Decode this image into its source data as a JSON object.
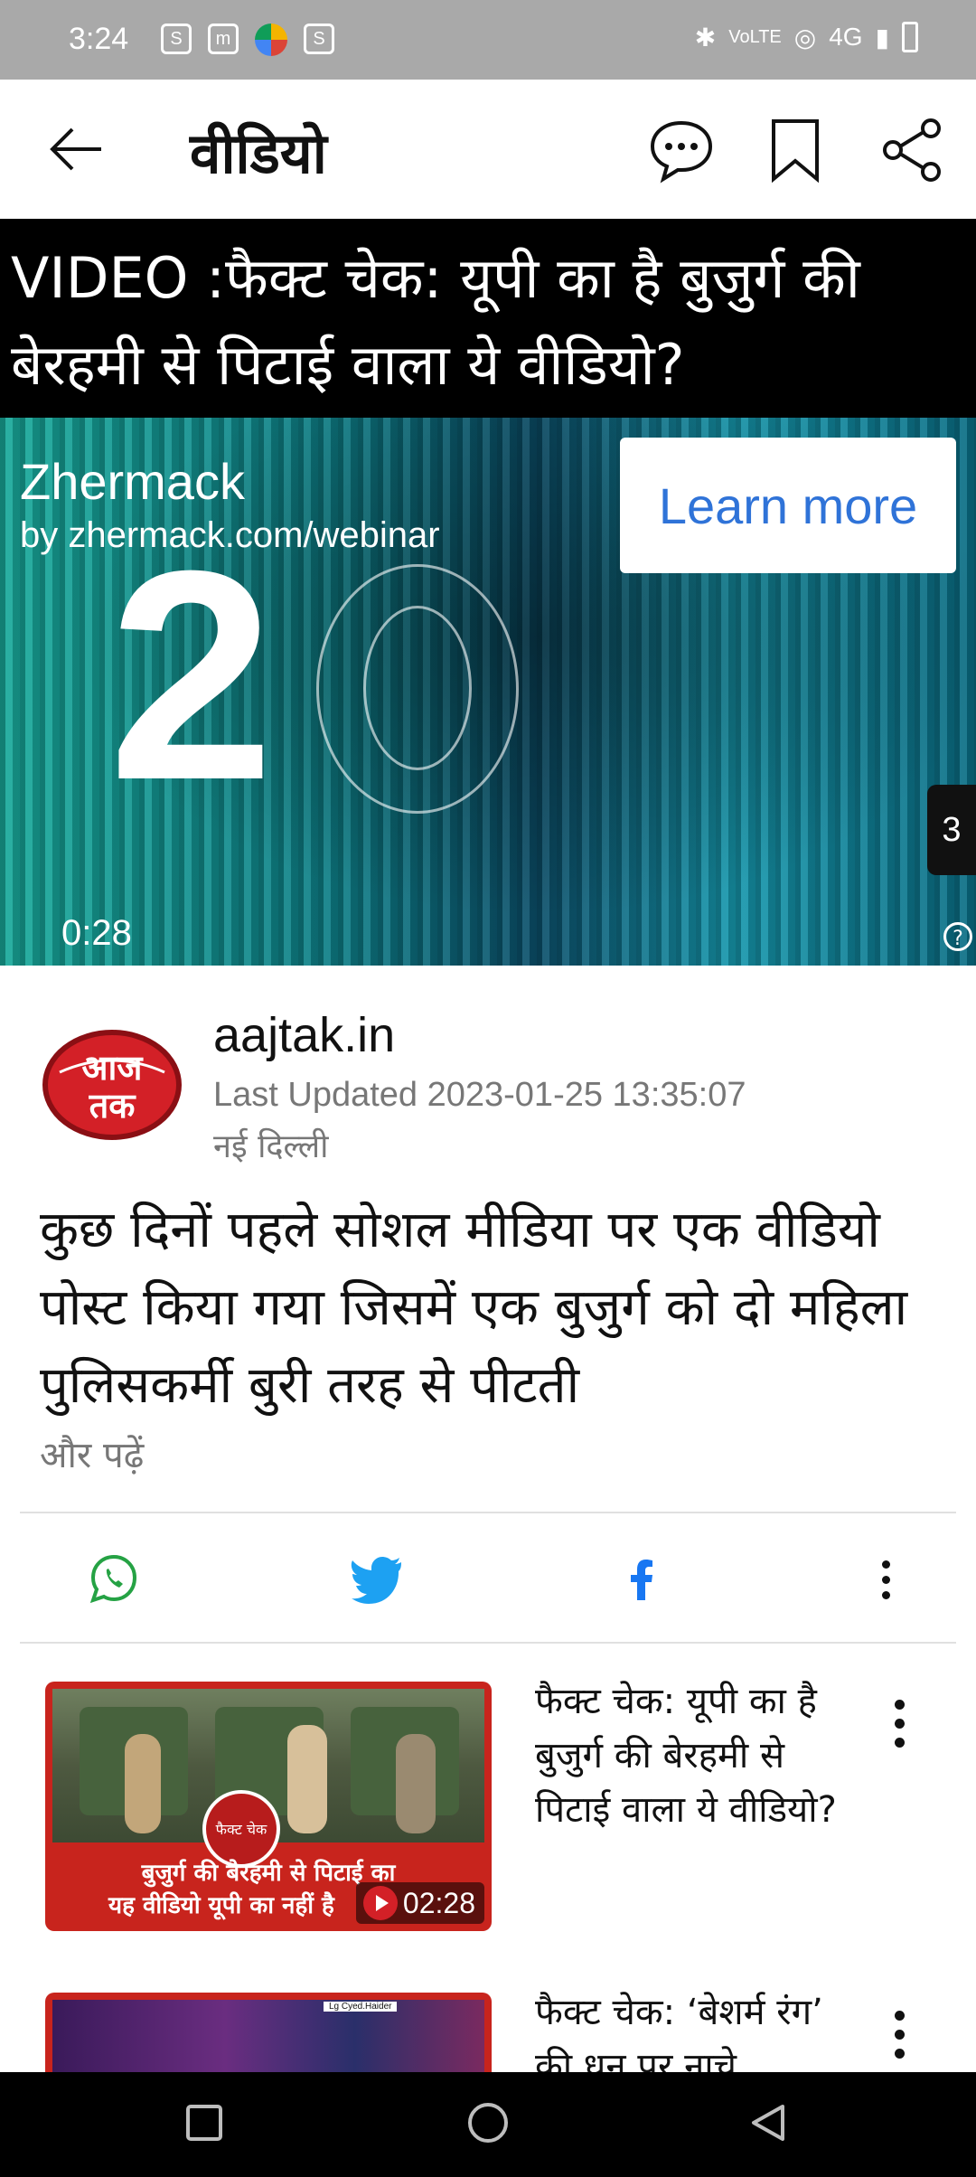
{
  "status_bar": {
    "time": "3:24",
    "network": "4G",
    "icons": [
      "sim-icon",
      "app-icon",
      "chrome-icon",
      "sim-icon",
      "bluetooth-icon",
      "volte-icon",
      "hotspot-icon",
      "signal-icon",
      "battery-icon"
    ]
  },
  "app_bar": {
    "title": "वीडियो",
    "icons": [
      "back-arrow-icon",
      "comment-icon",
      "bookmark-icon",
      "share-icon"
    ]
  },
  "headline": "VIDEO :फैक्ट चेक: यूपी का है बुजुर्ग की बेरहमी से पिटाई वाला ये वीडियो?",
  "video": {
    "ad_name": "Zhermack",
    "ad_source": "by zhermack.com/webinar",
    "cta_label": "Learn more",
    "big_text": "2",
    "duration": "0:28",
    "count_badge": "3",
    "help_icon": "?"
  },
  "source": {
    "logo_text": "आज तक",
    "name": "aajtak.in",
    "updated": "Last Updated 2023-01-25 13:35:07",
    "place": "नई दिल्ली"
  },
  "summary": "कुछ दिनों पहले सोशल मीडिया पर एक वीडियो पोस्ट किया गया जिसमें एक बुजुर्ग को दो महिला पुलिसकर्मी बुरी तरह से पीटती",
  "read_more": "और पढ़ें",
  "share_row": [
    "whatsapp-icon",
    "twitter-icon",
    "facebook-icon",
    "more-icon"
  ],
  "related": [
    {
      "title": "फैक्ट चेक: यूपी का है बुजुर्ग की बेरहमी से पिटाई वाला ये वीडियो?",
      "thumb_caption_1": "बुजुर्ग की बेरहमी से पिटाई का",
      "thumb_caption_2": "यह वीडियो यूपी का नहीं है",
      "stamp": "फैक्ट चेक",
      "duration": "02:28"
    },
    {
      "title": "फैक्ट चेक: ‘बेशर्म रंग’ की धुन पर नाचे",
      "thumb_label": "Lg Cyed.Haider"
    }
  ],
  "colors": {
    "status_bar": "#a9a9a9",
    "headline_bg": "#000000",
    "cta_text": "#2f73d8",
    "whatsapp": "#25a244",
    "twitter": "#1da1f2",
    "facebook": "#1877f2",
    "brand_red": "#d32027"
  }
}
